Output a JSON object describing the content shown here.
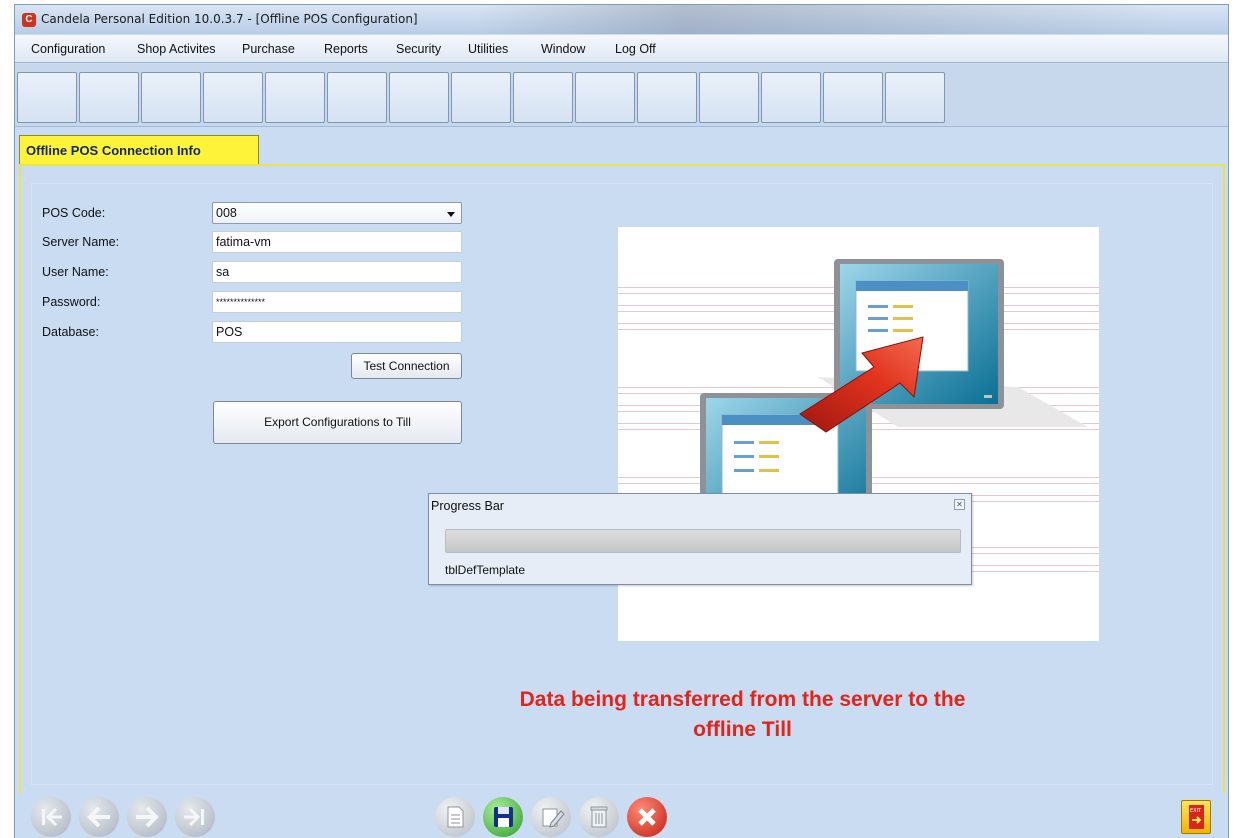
{
  "window": {
    "title": "Candela Personal Edition 10.0.3.7 - [Offline POS Configuration]"
  },
  "menu": [
    "Configuration",
    "Shop Activites",
    "Purchase",
    "Reports",
    "Security",
    "Utilities",
    "Window",
    "Log Off"
  ],
  "tab": {
    "label": "Offline POS Connection Info"
  },
  "form": {
    "pos_code": {
      "label": "POS Code:",
      "value": "008"
    },
    "server_name": {
      "label": "Server Name:",
      "value": "fatima-vm"
    },
    "user_name": {
      "label": "User Name:",
      "value": "sa"
    },
    "password": {
      "label": "Password:",
      "value": "**************"
    },
    "database": {
      "label": "Database:",
      "value": "POS"
    },
    "test_connection_label": "Test Connection",
    "export_label": "Export Configurations to Till"
  },
  "progress": {
    "title": "Progress Bar",
    "status": "tblDefTemplate",
    "fraction": 0
  },
  "caption": {
    "line1": "Data being transferred from the server to the",
    "line2": "offline Till"
  },
  "bottom": {
    "exit_text": "EXIT"
  },
  "colors": {
    "tab_yellow": "#fff33a",
    "caption_red": "#e3241b",
    "window_bg": "#c9dcf2"
  }
}
